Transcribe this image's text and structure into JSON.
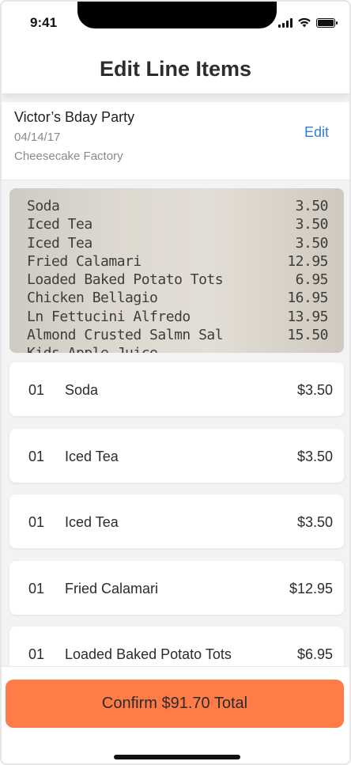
{
  "status_bar": {
    "time": "9:41"
  },
  "header": {
    "title": "Edit Line Items"
  },
  "event": {
    "name": "Victor’s Bday Party",
    "date": "04/14/17",
    "place": "Cheesecake Factory",
    "edit_label": "Edit"
  },
  "receipt": {
    "lines": [
      {
        "name": "Soda",
        "price": "3.50"
      },
      {
        "name": "Iced Tea",
        "price": "3.50"
      },
      {
        "name": "Iced Tea",
        "price": "3.50"
      },
      {
        "name": "Fried Calamari",
        "price": "12.95"
      },
      {
        "name": "Loaded Baked Potato Tots",
        "price": "6.95"
      },
      {
        "name": "Chicken Bellagio",
        "price": "16.95"
      },
      {
        "name": "Ln Fettucini Alfredo",
        "price": "13.95"
      },
      {
        "name": "Almond Crusted Salmn Sal",
        "price": "15.50"
      },
      {
        "name": "Kids Apple Juice",
        "price": ""
      }
    ]
  },
  "items": [
    {
      "qty": "01",
      "name": "Soda",
      "price": "$3.50"
    },
    {
      "qty": "01",
      "name": "Iced Tea",
      "price": "$3.50"
    },
    {
      "qty": "01",
      "name": "Iced Tea",
      "price": "$3.50"
    },
    {
      "qty": "01",
      "name": "Fried Calamari",
      "price": "$12.95"
    },
    {
      "qty": "01",
      "name": "Loaded Baked Potato Tots",
      "price": "$6.95"
    }
  ],
  "confirm": {
    "label": "Confirm $91.70 Total"
  },
  "colors": {
    "accent": "#ff7b47",
    "link": "#2f7fd6"
  }
}
